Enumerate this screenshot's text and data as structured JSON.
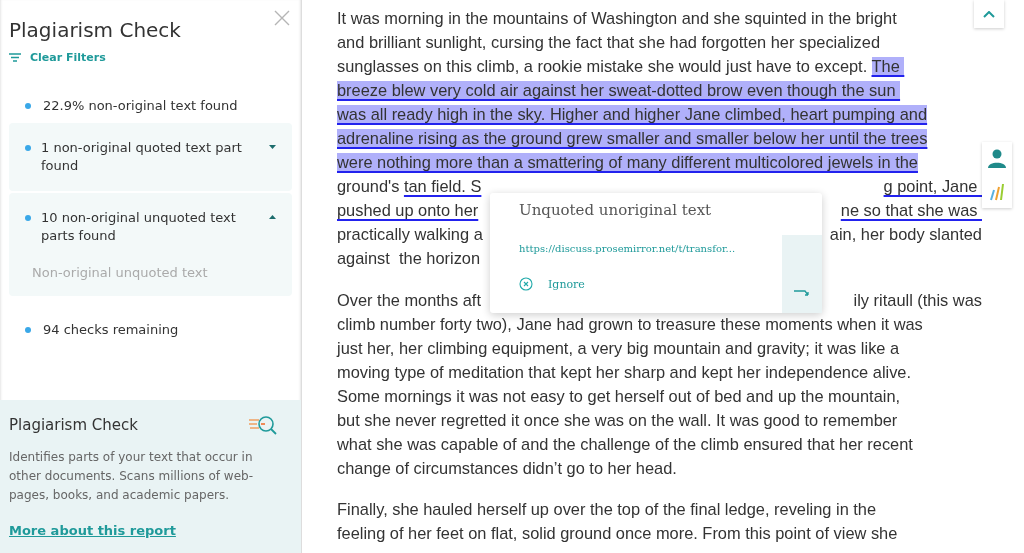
{
  "sidebar": {
    "title": "Plagiarism Check",
    "clear_filters": "Clear Filters",
    "items": [
      {
        "kind": "plain",
        "label": "22.9% non-original text found"
      },
      {
        "kind": "expandable",
        "label": "1 non-original quoted text part found",
        "expanded": false
      },
      {
        "kind": "expandable",
        "label": "10 non-original unquoted text parts found",
        "expanded": true,
        "filter_placeholder": "Non-original unquoted text"
      },
      {
        "kind": "plain",
        "label": "94 checks remaining"
      }
    ],
    "info": {
      "title": "Plagiarism Check",
      "description": "Identifies parts of your text that occur in other documents. Scans millions of web-pages, books, and academic papers.",
      "link": "More about this report"
    }
  },
  "document": {
    "paragraphs": [
      {
        "lines": [
          {
            "left": [
              {
                "kind": "plain",
                "text": "It was morning in the mountains of Washington and she squinted in the bright"
              }
            ]
          },
          {
            "left": [
              {
                "kind": "plain",
                "text": "and brilliant sunlight, cursing the fact that she had forgotten her specialized"
              }
            ]
          },
          {
            "left": [
              {
                "kind": "plain",
                "text": "sunglasses on this climb, a rookie mistake she would just have to except. "
              },
              {
                "kind": "highlight",
                "text": "The "
              }
            ]
          },
          {
            "left": [
              {
                "kind": "highlight",
                "text": "breeze blew very cold air against her sweat-dotted brow even though the sun "
              }
            ]
          },
          {
            "left": [
              {
                "kind": "highlight",
                "text": "was all ready high in the sky. Higher and higher Jane climbed, heart pumping and"
              }
            ]
          },
          {
            "left": [
              {
                "kind": "highlight",
                "text": "adrenaline rising as the ground grew smaller and smaller below her until the trees"
              }
            ]
          },
          {
            "left": [
              {
                "kind": "highlight",
                "text": "were nothing more than a smattering of many different multicolored jewels in the"
              }
            ]
          },
          {
            "left": [
              {
                "kind": "plain",
                "text": "ground's "
              },
              {
                "kind": "underline",
                "text": "tan field. S"
              }
            ],
            "right": [
              {
                "kind": "underline",
                "text": "g point, Jane "
              }
            ]
          },
          {
            "left": [
              {
                "kind": "underline",
                "text": "pushed up onto her"
              }
            ],
            "right": [
              {
                "kind": "underline",
                "text": "ne so that she was "
              }
            ]
          },
          {
            "left": [
              {
                "kind": "plain",
                "text": "practically walking a"
              }
            ],
            "right": [
              {
                "kind": "plain",
                "text": "ain, her body slanted"
              }
            ]
          },
          {
            "left": [
              {
                "kind": "plain",
                "text": "against  the horizon"
              }
            ]
          }
        ]
      },
      {
        "lines": [
          {
            "left": [
              {
                "kind": "plain",
                "text": "Over the months aft"
              }
            ],
            "right": [
              {
                "kind": "plain",
                "text": "ily ritaull (this was"
              }
            ]
          },
          {
            "left": [
              {
                "kind": "plain",
                "text": "climb number forty two), Jane had grown to treasure these moments when it was"
              }
            ]
          },
          {
            "left": [
              {
                "kind": "plain",
                "text": "just her, her climbing equipment, a very big mountain and gravity; it was like a"
              }
            ]
          },
          {
            "left": [
              {
                "kind": "plain",
                "text": "moving type of meditation that kept her sharp and kept her independence alive."
              }
            ]
          },
          {
            "left": [
              {
                "kind": "plain",
                "text": "Some mornings it was not easy to get herself out of bed and up the mountain,"
              }
            ]
          },
          {
            "left": [
              {
                "kind": "plain",
                "text": "but she never regretted it once she was on the wall. It was good to remember"
              }
            ]
          },
          {
            "left": [
              {
                "kind": "plain",
                "text": "what she was capable of and the challenge of the climb ensured that her recent"
              }
            ]
          },
          {
            "left": [
              {
                "kind": "plain",
                "text": "change of circumstances didn’t go to her head."
              }
            ]
          }
        ]
      },
      {
        "lines": [
          {
            "left": [
              {
                "kind": "plain",
                "text": "Finally, she hauled herself up over the top of the final ledge, reveling in the"
              }
            ]
          },
          {
            "left": [
              {
                "kind": "plain",
                "text": "feeling of her feet on flat, solid ground once more. From this point of view she"
              }
            ]
          }
        ]
      }
    ]
  },
  "popup": {
    "title": "Unquoted unoriginal text",
    "source": "https://discuss.prosemirror.net/t/transfor...",
    "ignore": "Ignore"
  }
}
